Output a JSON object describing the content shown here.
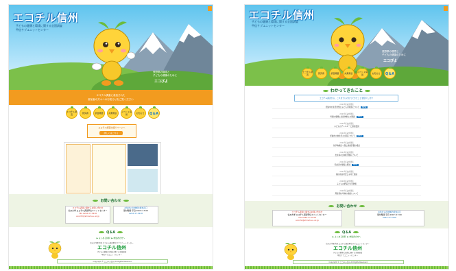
{
  "site": {
    "title": "エコチル信州",
    "tagline_lines": [
      "子どもの健康と環境に関する全国調査",
      "甲信サブユニットセンター"
    ],
    "character_caption_lines": [
      "長野県の環境と",
      "子どもの健康のために"
    ],
    "character_name": "エコぴよ"
  },
  "banner": {
    "lines": [
      "エコチル調査に参加された",
      "参加者の方々へのお知らせをご覧ください"
    ]
  },
  "nav": {
    "items": [
      "エコチル調査",
      "研究者",
      "調査概要",
      "成果発表",
      "イベント情報",
      "お知らせ",
      "Q＆A"
    ]
  },
  "notice": {
    "text": "エコチル調査の紹介ページへ",
    "button_label": "詳しくはこちら"
  },
  "sections": {
    "news_heading": "お問い合わせ",
    "qa_heading": "Q＆A",
    "findings_heading": "わかってきたこと"
  },
  "contact": {
    "left_lines": [
      "エコチル調査に関するお問い合わせ",
      "信州大学 エコチル調査甲信ユニットセンター",
      "TEL 0263-37-3418",
      "ecochil@shinshu-u.ac.jp"
    ],
    "right_lines": [
      "お住まいの地域の担当窓口",
      "受付時間 平日 9:00〜17:00",
      "0263-37-3418"
    ]
  },
  "qa_links": [
    "▶ よくある質問",
    "▶ 参加者の方へ"
  ],
  "footer": {
    "org_line": "信州大学医学部 エコチル調査甲信サブユニットセンター",
    "logo_text": "エコチル信州",
    "sub_lines": [
      "子どもの健康と環境に関する全国調査",
      "甲信サブユニットセンター"
    ],
    "copyright": "Copyright © エコチル信州 All Rights Reserved."
  },
  "findings": {
    "intro": "エコチル調査から、これまでにわかってきたことを紹介します",
    "items": [
      {
        "date": "2023年 論文発表",
        "title": "妊娠中の生活習慣と子どもの発達について",
        "badge": "NEW"
      },
      {
        "date": "2023年 論文発表",
        "title": "母親の喫煙と出生体重との関連",
        "badge": "NEW"
      },
      {
        "date": "2022年 論文発表",
        "title": "子どものアレルギーと環境要因",
        "badge": ""
      },
      {
        "date": "2022年 論文発表",
        "title": "妊娠中の食生活と出産について",
        "badge": "NEW"
      },
      {
        "date": "2022年 論文発表",
        "title": "化学物質ばく露と健康影響の検討",
        "badge": ""
      },
      {
        "date": "2021年 論文発表",
        "title": "出生時の身体計測値について",
        "badge": ""
      },
      {
        "date": "2021年 論文発表",
        "title": "乳幼児の睡眠と発達",
        "badge": "NEW"
      },
      {
        "date": "2021年 論文発表",
        "title": "親の就労状況と子育て環境",
        "badge": ""
      },
      {
        "date": "2020年 論文発表",
        "title": "子どもの肥満と生活習慣",
        "badge": ""
      },
      {
        "date": "2020年 論文発表",
        "title": "周産期の母体の健康について",
        "badge": ""
      }
    ]
  },
  "colors": {
    "orange": "#f29b1f",
    "sky": "#5fc4ee",
    "green": "#6bbb3a",
    "mascot_yellow": "#ffd43a"
  }
}
